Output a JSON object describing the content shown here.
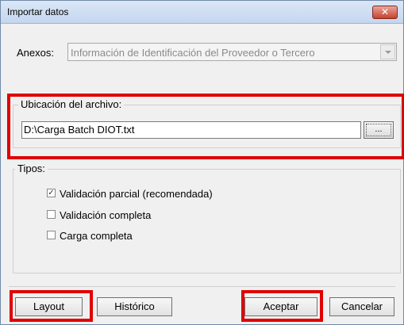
{
  "window": {
    "title": "Importar datos",
    "close_glyph": "✕"
  },
  "anexos": {
    "label": "Anexos:",
    "selected": "Información de Identificación del Proveedor o Tercero"
  },
  "ubicacion": {
    "legend": "Ubicación del archivo:",
    "path": "D:\\Carga Batch DIOT.txt",
    "browse_label": "..."
  },
  "tipos": {
    "legend": "Tipos:",
    "options": [
      {
        "label": "Validación parcial (recomendada)",
        "mark": "✓"
      },
      {
        "label": "Validación completa",
        "mark": ""
      },
      {
        "label": "Carga completa",
        "mark": ""
      }
    ]
  },
  "buttons": {
    "layout": "Layout",
    "historico": "Histórico",
    "aceptar": "Aceptar",
    "cancelar": "Cancelar"
  },
  "colors": {
    "highlight": "#e00000",
    "close_button": "#c7412e"
  }
}
